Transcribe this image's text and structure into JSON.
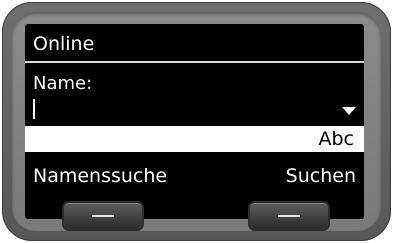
{
  "screen": {
    "title": "Online",
    "field_label": "Name:",
    "input_mode": "Abc"
  },
  "softkeys": {
    "left": "Namenssuche",
    "right": "Suchen"
  }
}
